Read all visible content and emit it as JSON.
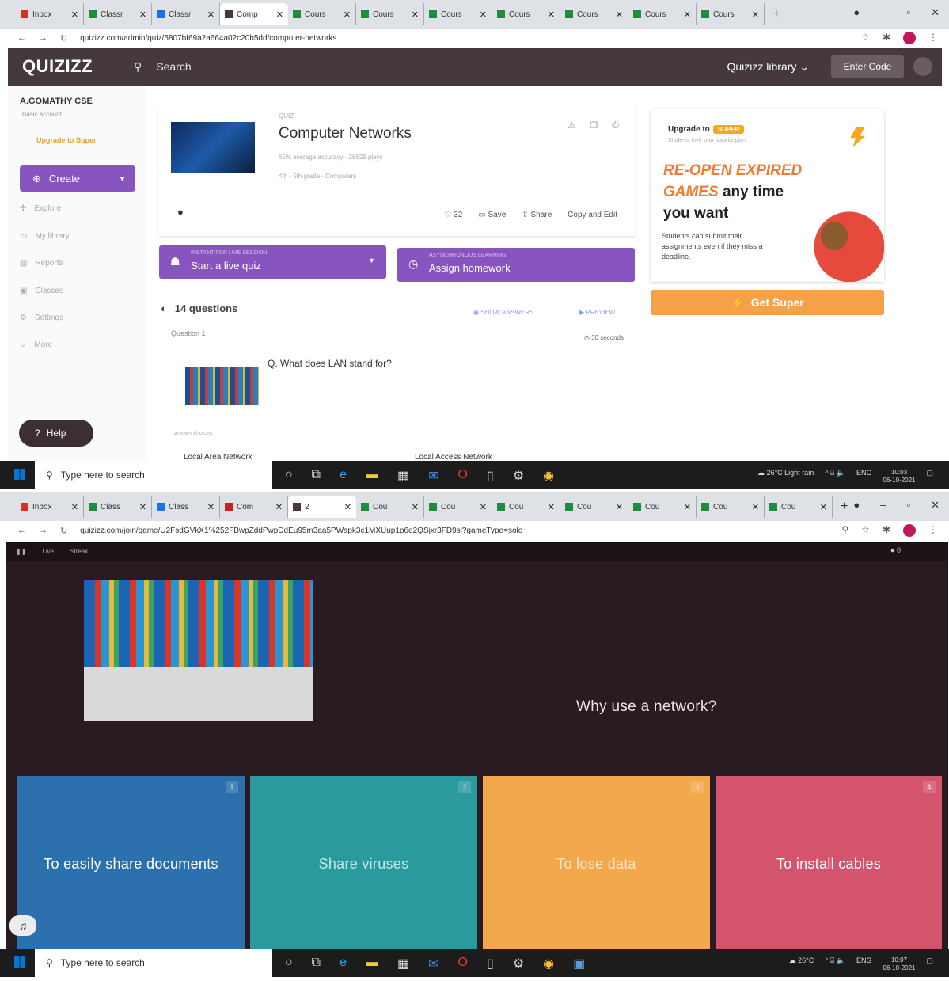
{
  "colors": {
    "quizizz_header": "#46383f",
    "purple_primary": "#8854c0",
    "super_orange": "#f5a623",
    "game_bg": "#2a1a21",
    "option_blue": "#2d70ae",
    "option_teal": "#2b9a9e",
    "option_orange": "#f3a84d",
    "option_red": "#d5546d"
  },
  "screen1": {
    "tabs": [
      {
        "label": "Inbox",
        "icon": "gmail-icon",
        "color": "#d93025"
      },
      {
        "label": "Classr",
        "icon": "classroom-icon",
        "color": "#1e8e3e"
      },
      {
        "label": "Classr",
        "icon": "classroom-icon",
        "color": "#1a73e8"
      },
      {
        "label": "Comp",
        "icon": "quizizz-icon",
        "color": "#46383f"
      },
      {
        "label": "Cours",
        "icon": "classroom-icon",
        "color": "#1e8e3e"
      },
      {
        "label": "Cours",
        "icon": "classroom-icon",
        "color": "#1e8e3e"
      },
      {
        "label": "Cours",
        "icon": "classroom-icon",
        "color": "#1e8e3e"
      },
      {
        "label": "Cours",
        "icon": "classroom-icon",
        "color": "#1e8e3e"
      },
      {
        "label": "Cours",
        "icon": "classroom-icon",
        "color": "#1e8e3e"
      },
      {
        "label": "Cours",
        "icon": "classroom-icon",
        "color": "#1e8e3e"
      },
      {
        "label": "Cours",
        "icon": "classroom-icon",
        "color": "#1e8e3e"
      }
    ],
    "url": "quizizz.com/admin/quiz/5807bf69a2a664a02c20b5dd/computer-networks",
    "logo": "QUIZIZZ",
    "search_label": "Search",
    "library_label": "Quizizz library",
    "enter_code": "Enter Code",
    "user_name": "A.GOMATHY CSE",
    "account_type": "Basic account",
    "upgrade_link": "Upgrade to Super",
    "create_label": "Create",
    "nav": [
      "Explore",
      "My library",
      "Reports",
      "Classes",
      "Settings",
      "More"
    ],
    "help_label": "Help",
    "quiz": {
      "type_label": "QUIZ",
      "title": "Computer Networks",
      "stats": "65% average accuracy · 28629 plays",
      "meta": "4th - 5th grade · Computers",
      "likes": "32",
      "save": "Save",
      "share": "Share",
      "copy_edit": "Copy and Edit"
    },
    "live_button": {
      "small": "INSTANT FOR LIVE SESSION",
      "main": "Start a live quiz"
    },
    "homework_button": {
      "small": "ASYNCHRONOUS LEARNING",
      "main": "Assign homework"
    },
    "question_count": "14 questions",
    "show_answers": "SHOW ANSWERS",
    "preview": "PREVIEW",
    "question_label": "Question 1",
    "question_seconds": "30 seconds",
    "question_text": "Q. What does LAN stand for?",
    "answer_choices_label": "answer choices",
    "answer_1": "Local Area Network",
    "answer_2": "Local Access Network",
    "upgrade": {
      "title": "Upgrade to",
      "badge": "SUPER",
      "subtitle": "Students love your favorite plan",
      "headline_orange1": "RE-OPEN EXPIRED",
      "headline_orange2": "GAMES",
      "headline_dark1": "any time",
      "headline_dark2": "you want",
      "body": "Students can submit their assignments even if they miss a deadline.",
      "cta": "Get Super"
    },
    "taskbar": {
      "search": "Type here to search",
      "weather": "26°C Light rain",
      "lang": "ENG",
      "time": "10:03",
      "date": "06-10-2021"
    }
  },
  "screen2": {
    "tabs": [
      {
        "label": "Inbox",
        "icon": "gmail-icon",
        "color": "#d93025"
      },
      {
        "label": "Class",
        "icon": "classroom-icon",
        "color": "#1e8e3e"
      },
      {
        "label": "Class",
        "icon": "classroom-icon",
        "color": "#1a73e8"
      },
      {
        "label": "Com",
        "icon": "quizizz-icon",
        "color": "#c5221f"
      },
      {
        "label": "2",
        "icon": "quizizz-icon",
        "color": "#46383f"
      },
      {
        "label": "Cou",
        "icon": "classroom-icon",
        "color": "#1e8e3e"
      },
      {
        "label": "Cou",
        "icon": "classroom-icon",
        "color": "#1e8e3e"
      },
      {
        "label": "Cou",
        "icon": "classroom-icon",
        "color": "#1e8e3e"
      },
      {
        "label": "Cou",
        "icon": "classroom-icon",
        "color": "#1e8e3e"
      },
      {
        "label": "Cou",
        "icon": "classroom-icon",
        "color": "#1e8e3e"
      },
      {
        "label": "Cou",
        "icon": "classroom-icon",
        "color": "#1e8e3e"
      },
      {
        "label": "Cou",
        "icon": "classroom-icon",
        "color": "#1e8e3e"
      }
    ],
    "url": "quizizz.com/join/game/U2FsdGVkX1%252FBwpZddPwpDdEu95m3aa5PWapk3c1MXUup1p6e2QSjxr3FD9sl?gameType=solo",
    "topbar_left": "Live",
    "topbar_streak": "Streak",
    "score": "0",
    "question": "Why use a network?",
    "options": [
      {
        "num": "1",
        "text": "To easily share documents"
      },
      {
        "num": "2",
        "text": "Share viruses"
      },
      {
        "num": "3",
        "text": "To lose data"
      },
      {
        "num": "4",
        "text": "To install cables"
      }
    ],
    "taskbar": {
      "search": "Type here to search",
      "weather": "26°C",
      "lang": "ENG",
      "time": "10:07",
      "date": "06-10-2021"
    }
  }
}
